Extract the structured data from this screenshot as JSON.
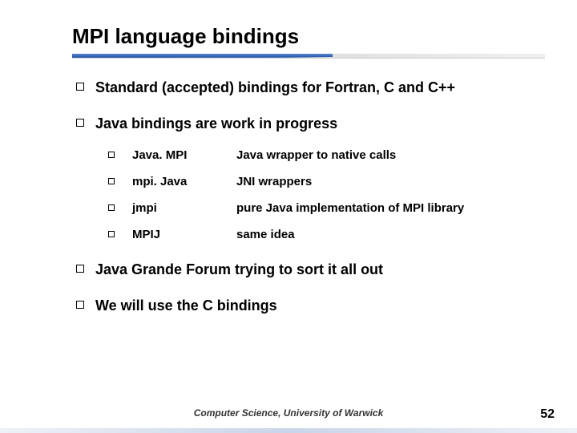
{
  "title": "MPI language bindings",
  "bullets": [
    {
      "text": "Standard (accepted) bindings for Fortran, C and C++"
    },
    {
      "text": "Java bindings are work in progress"
    }
  ],
  "sub_items": [
    {
      "name": "Java. MPI",
      "desc": "Java wrapper to native calls"
    },
    {
      "name": "mpi. Java",
      "desc": "JNI wrappers"
    },
    {
      "name": "jmpi",
      "desc": "pure Java implementation of MPI library"
    },
    {
      "name": "MPIJ",
      "desc": "same idea"
    }
  ],
  "bullets2": [
    {
      "text": "Java Grande Forum trying to sort it all out"
    },
    {
      "text": "We will use the C bindings"
    }
  ],
  "footer": "Computer Science, University of Warwick",
  "page": "52"
}
